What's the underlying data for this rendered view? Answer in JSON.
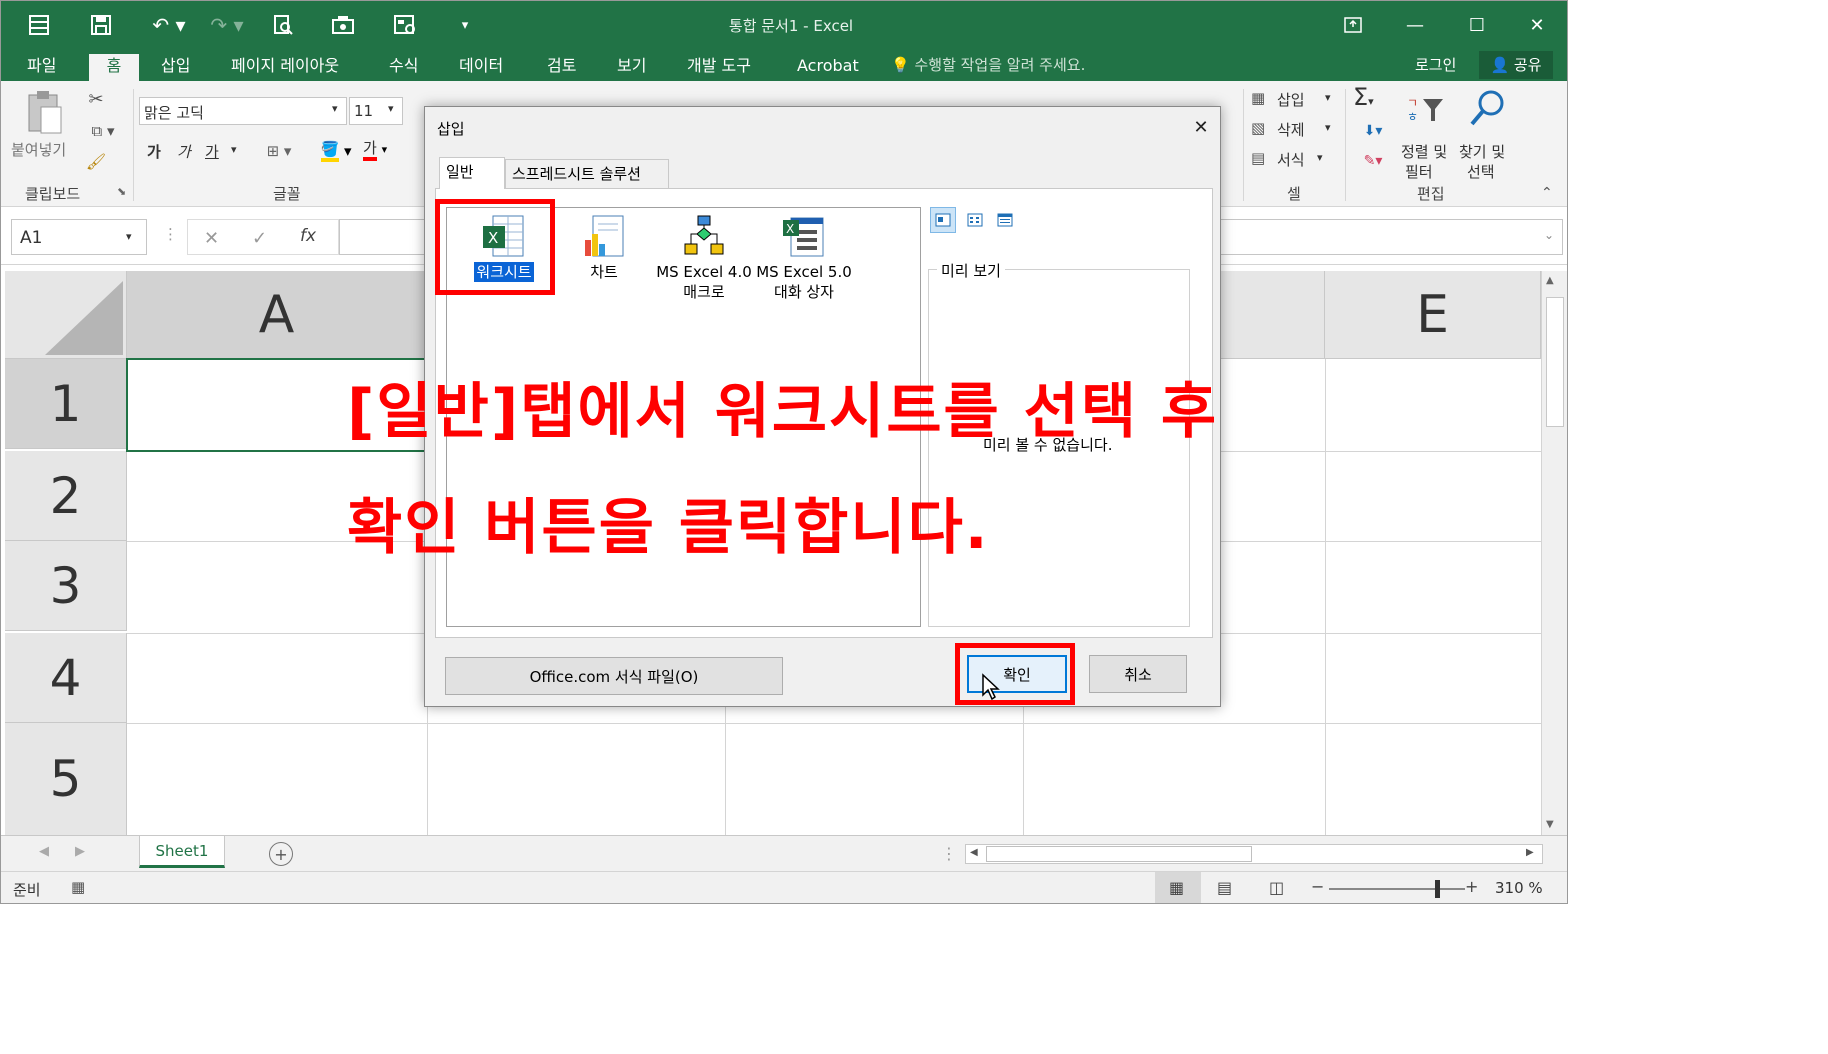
{
  "window": {
    "title": "통합 문서1 - Excel"
  },
  "quick_access": [
    "save-icon",
    "undo-icon",
    "redo-icon",
    "print-preview-icon",
    "camera-icon",
    "form-icon",
    "customize-icon"
  ],
  "tabs": [
    {
      "label": "파일"
    },
    {
      "label": "홈",
      "active": true
    },
    {
      "label": "삽입"
    },
    {
      "label": "페이지 레이아웃"
    },
    {
      "label": "수식"
    },
    {
      "label": "데이터"
    },
    {
      "label": "검토"
    },
    {
      "label": "보기"
    },
    {
      "label": "개발 도구"
    },
    {
      "label": "Acrobat"
    }
  ],
  "tell_me": "수행할 작업을 알려 주세요.",
  "signin": "로그인",
  "share": "공유",
  "ribbon": {
    "paste_label": "붙여넣기",
    "clipboard_group": "클립보드",
    "font_name": "맑은 고딕",
    "font_size": "11",
    "font_group": "글꼴",
    "bold": "가",
    "italic": "가",
    "underline": "가",
    "font_color_glyph": "가",
    "cells_insert": "삽입",
    "cells_delete": "삭제",
    "cells_format": "서식",
    "cells_group": "셀",
    "sort_filter_1": "정렬 및",
    "sort_filter_2": "필터",
    "find_select_1": "찾기 및",
    "find_select_2": "선택",
    "editing_group": "편집",
    "autosum": "Σ"
  },
  "formula_bar": {
    "name_box": "A1",
    "fx": "fx",
    "cancel": "✕",
    "enter": "✓"
  },
  "grid": {
    "columns": [
      "A",
      "E"
    ],
    "rows": [
      "1",
      "2",
      "3",
      "4",
      "5"
    ]
  },
  "sheet_tabs": [
    {
      "label": "Sheet1",
      "active": true
    }
  ],
  "status": {
    "ready": "준비",
    "zoom": "310 %"
  },
  "dialog": {
    "title": "삽입",
    "tabs": [
      {
        "label": "일반",
        "active": true
      },
      {
        "label": "스프레드시트 솔루션"
      }
    ],
    "items": [
      {
        "label": "워크시트",
        "selected": true
      },
      {
        "label": "차트"
      },
      {
        "label1": "MS Excel 4.0",
        "label2": "매크로"
      },
      {
        "label1": "MS Excel 5.0",
        "label2": "대화 상자"
      }
    ],
    "preview_label": "미리 보기",
    "preview_empty": "미리 볼 수 없습니다.",
    "office_button": "Office.com 서식 파일(O)",
    "ok_button": "확인",
    "cancel_button": "취소"
  },
  "annotation": {
    "line1": "[일반]탭에서 워크시트를 선택 후",
    "line2": "확인 버튼을 클릭합니다."
  },
  "colors": {
    "excel_green": "#217346",
    "highlight_red": "#ff0000",
    "selection_blue": "#0a64d6"
  }
}
